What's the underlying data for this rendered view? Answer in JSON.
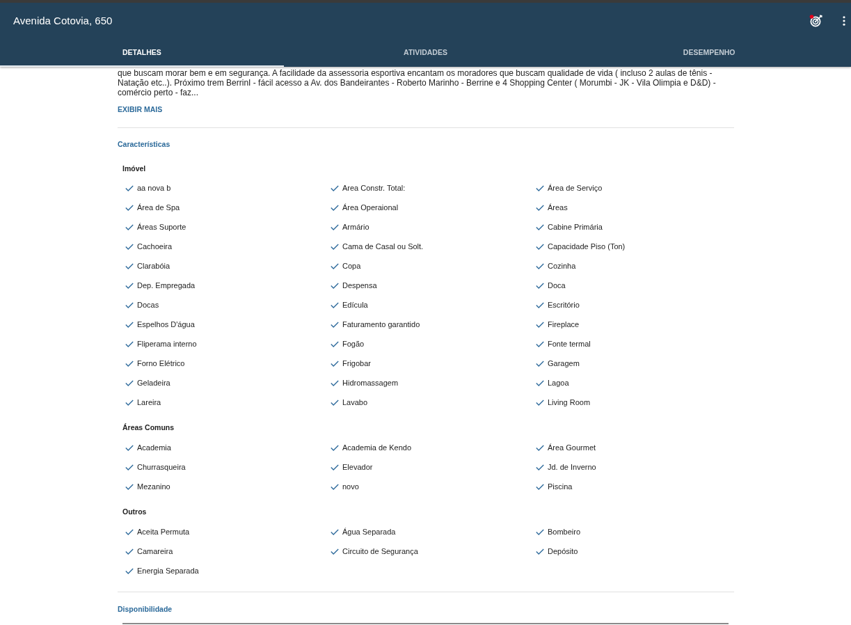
{
  "window": {
    "title": "Avenida Cotovia, 650"
  },
  "tabs": [
    {
      "label": "DETALHES",
      "selected": true
    },
    {
      "label": "ATIVIDADES",
      "selected": false
    },
    {
      "label": "DESEMPENHO",
      "selected": false
    }
  ],
  "description": {
    "text": "que buscam morar bem e em segurança. A facilidade da assessoria esportiva encantam os moradores que buscam qualidade de vida ( incluso 2 aulas de tênis - Natação etc..). Próximo trem BerrinI - fácil acesso a Av. dos Bandeirantes - Roberto Marinho - Berrine e 4 Shopping Center ( Morumbi - JK - Vila Olimpia e D&D) - comércio perto - faz...",
    "more_link": "EXIBIR MAIS"
  },
  "features": {
    "title": "Características",
    "groups": [
      {
        "title": "Imóvel",
        "items": [
          "aa nova b",
          "Area Constr. Total:",
          "Área de Serviço",
          "Área de Spa",
          "Área Operaional",
          "Áreas",
          "Áreas Suporte",
          "Armário",
          "Cabine Primária",
          "Cachoeira",
          "Cama de Casal ou Solt.",
          "Capacidade Piso (Ton)",
          "Clarabóia",
          "Copa",
          "Cozinha",
          "Dep. Empregada",
          "Despensa",
          "Doca",
          "Docas",
          "Edícula",
          "Escritório",
          "Espelhos D'água",
          "Faturamento garantido",
          "Fireplace",
          "Fliperama interno",
          "Fogão",
          "Fonte termal",
          "Forno Elétrico",
          "Frigobar",
          "Garagem",
          "Geladeira",
          "Hidromassagem",
          "Lagoa",
          "Lareira",
          "Lavabo",
          "Living Room"
        ]
      },
      {
        "title": "Áreas Comuns",
        "items": [
          "Academia",
          "Academia de Kendo",
          "Área Gourmet",
          "Churrasqueira",
          "Elevador",
          "Jd. de Inverno",
          "Mezanino",
          "novo",
          "Piscina"
        ]
      },
      {
        "title": "Outros",
        "items": [
          "Aceita Permuta",
          "Água Separada",
          "Bombeiro",
          "Camareira",
          "Circuito de Segurança",
          "Depósito",
          "Energia Separada"
        ]
      }
    ]
  },
  "availability": {
    "title": "Disponibilidade"
  }
}
